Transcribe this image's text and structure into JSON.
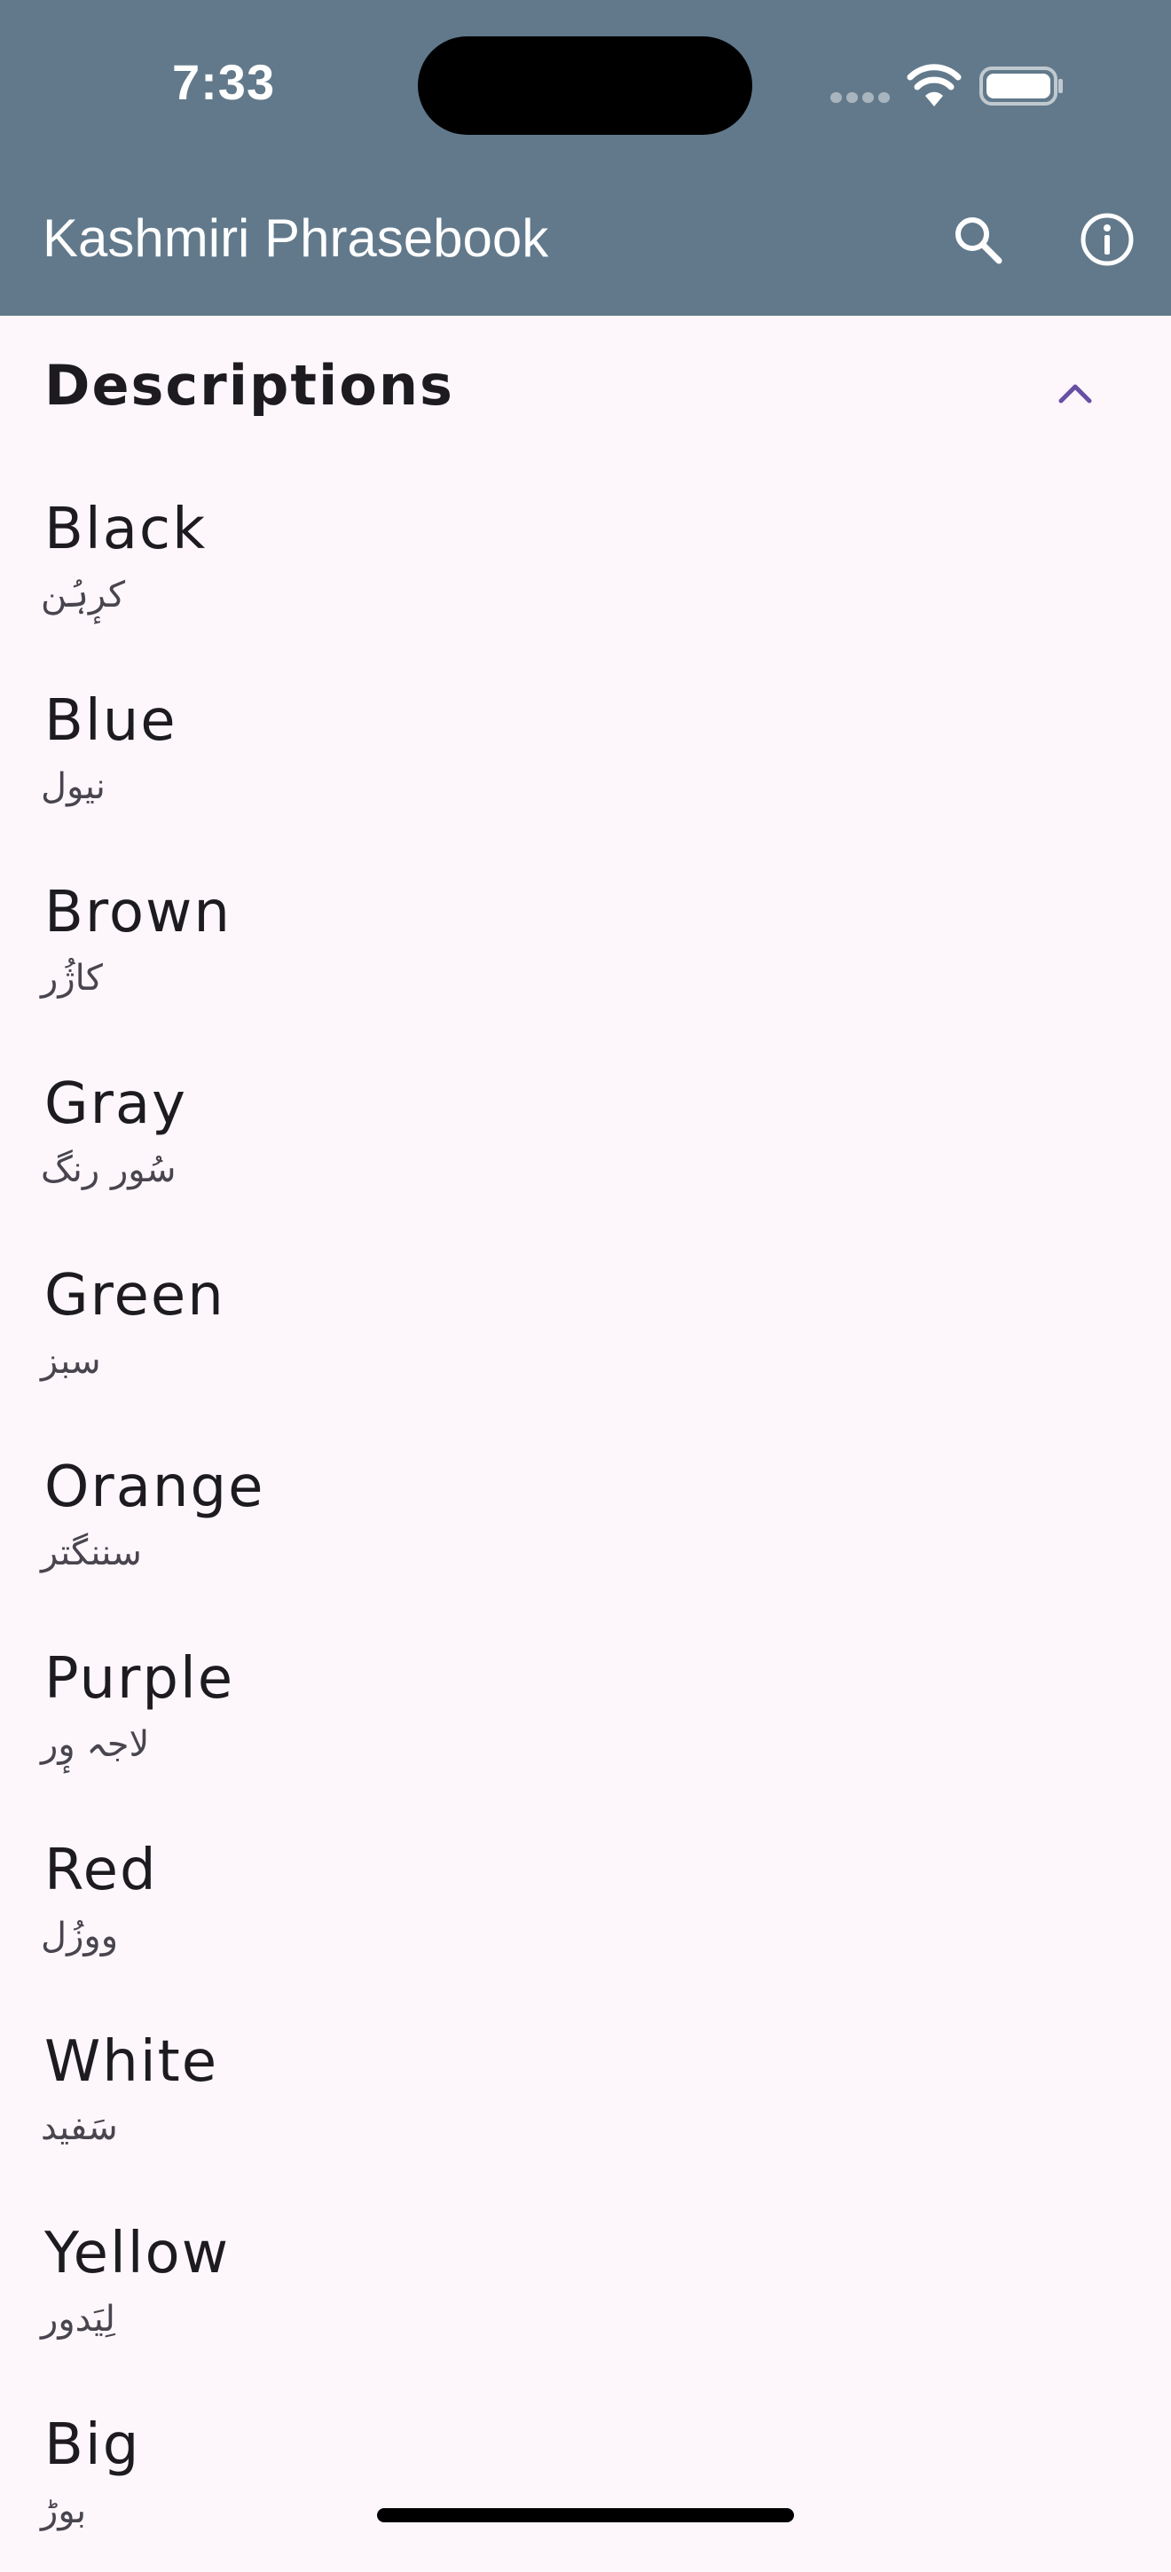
{
  "status_bar": {
    "time": "7:33"
  },
  "app_bar": {
    "title": "Kashmiri Phrasebook",
    "background": "#61798B",
    "icons": [
      "search-icon",
      "info-icon"
    ]
  },
  "section": {
    "title": "Descriptions",
    "expanded": true,
    "toggle_icon": "chevron-up-icon",
    "accent": "#6750A4"
  },
  "items": [
    {
      "english": "Black",
      "kashmiri": "کرٕہُن"
    },
    {
      "english": "Blue",
      "kashmiri": "نیول"
    },
    {
      "english": "Brown",
      "kashmiri": "کاژُر"
    },
    {
      "english": "Gray",
      "kashmiri": "سُور رنگ"
    },
    {
      "english": "Green",
      "kashmiri": "سبز"
    },
    {
      "english": "Orange",
      "kashmiri": "سننگتر"
    },
    {
      "english": "Purple",
      "kashmiri": "لاجہ وٕر"
    },
    {
      "english": "Red",
      "kashmiri": "ووزُل"
    },
    {
      "english": "White",
      "kashmiri": "سَفید"
    },
    {
      "english": "Yellow",
      "kashmiri": "لِیَدور"
    },
    {
      "english": "Big",
      "kashmiri": "بوڑ"
    }
  ]
}
